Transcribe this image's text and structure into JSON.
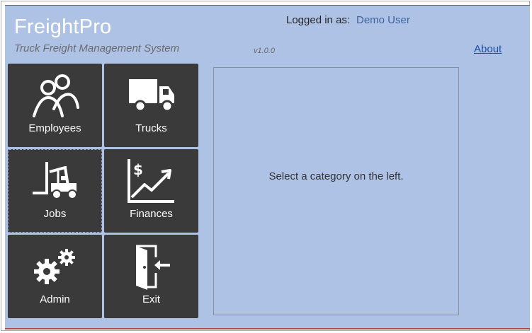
{
  "app": {
    "brand": "FreightPro",
    "tagline": "Truck Freight Management System",
    "version": "v1.0.0"
  },
  "header": {
    "login_label": "Logged in as:",
    "login_user": "Demo User",
    "about_link": "About"
  },
  "menu": {
    "employees": {
      "label": "Employees",
      "icon": "people-icon"
    },
    "trucks": {
      "label": "Trucks",
      "icon": "truck-icon"
    },
    "jobs": {
      "label": "Jobs",
      "icon": "forklift-icon"
    },
    "finances": {
      "label": "Finances",
      "icon": "finance-chart-icon"
    },
    "admin": {
      "label": "Admin",
      "icon": "gears-icon"
    },
    "exit": {
      "label": "Exit",
      "icon": "exit-door-icon"
    }
  },
  "content": {
    "message": "Select a category on the left."
  },
  "colors": {
    "background": "#aec2e6",
    "tile": "#3a3a3a",
    "link": "#1a4fa0",
    "user": "#3f62a0",
    "accent_border": "#b04a4a"
  }
}
